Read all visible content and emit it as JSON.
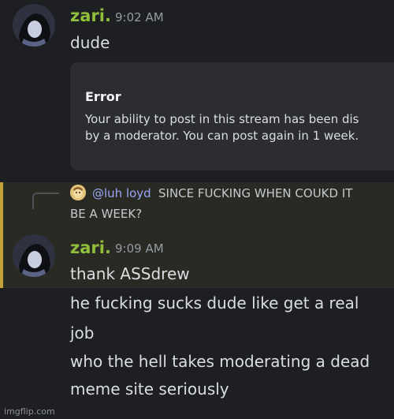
{
  "message1": {
    "username": "zari.",
    "timestamp": "9:02 AM",
    "text": "dude"
  },
  "embed": {
    "title": "Error",
    "body_line1": "Your ability to post in this stream has been dis",
    "body_line2": "by a moderator. You can post again in 1 week."
  },
  "reply": {
    "mention": "@luh loyd",
    "text_line1": "SINCE FUCKING WHEN COUKD IT",
    "text_line2": "BE A WEEK?"
  },
  "message2": {
    "username": "zari.",
    "timestamp": "9:09 AM",
    "lines": [
      "thank ASSdrew",
      "he fucking sucks dude like get a real",
      "job",
      "who the hell takes moderating a dead",
      "meme site seriously"
    ]
  },
  "watermark": "imgflip.com",
  "colors": {
    "background": "#1e1f22",
    "username": "#8fbf3a",
    "mention": "#9aa7f5",
    "highlight_bar": "#c5a13a"
  }
}
